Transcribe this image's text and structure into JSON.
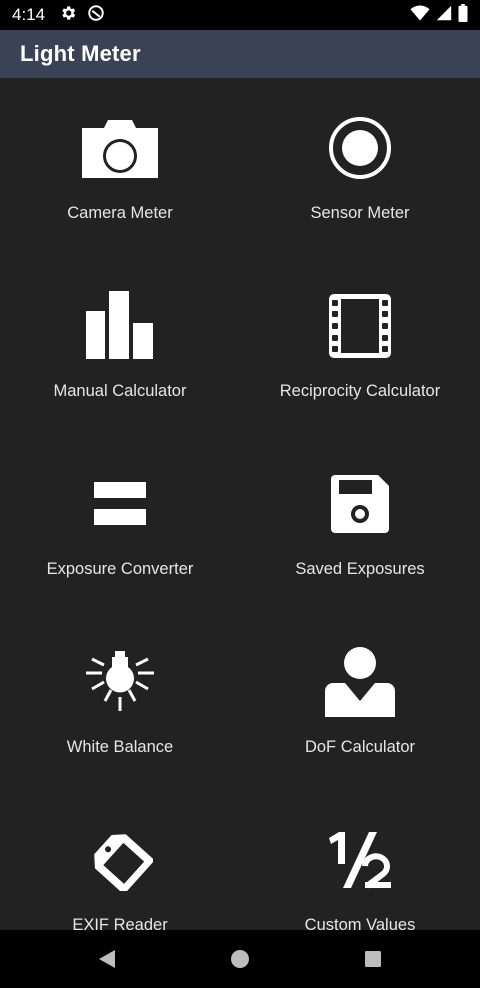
{
  "status_bar": {
    "time": "4:14",
    "left_icons": [
      "gear-icon",
      "do-not-disturb-icon"
    ],
    "right_icons": [
      "wifi-icon",
      "cell-signal-icon",
      "battery-icon"
    ]
  },
  "app_bar": {
    "title": "Light Meter"
  },
  "menu": {
    "items": [
      {
        "label": "Camera Meter",
        "icon": "camera-icon"
      },
      {
        "label": "Sensor Meter",
        "icon": "sensor-circle-icon"
      },
      {
        "label": "Manual Calculator",
        "icon": "bar-chart-icon"
      },
      {
        "label": "Reciprocity Calculator",
        "icon": "film-strip-icon"
      },
      {
        "label": "Exposure Converter",
        "icon": "equals-icon"
      },
      {
        "label": "Saved Exposures",
        "icon": "floppy-disk-icon"
      },
      {
        "label": "White Balance",
        "icon": "light-bulb-icon"
      },
      {
        "label": "DoF Calculator",
        "icon": "person-icon"
      },
      {
        "label": "EXIF Reader",
        "icon": "tag-icon"
      },
      {
        "label": "Custom Values",
        "icon": "one-half-icon"
      }
    ]
  },
  "nav_bar": {
    "buttons": [
      "back-icon",
      "home-icon",
      "recents-icon"
    ]
  },
  "colors": {
    "app_bar": "#3a4356",
    "background": "#222222",
    "icon": "#ffffff",
    "label": "#e6e6e6"
  }
}
